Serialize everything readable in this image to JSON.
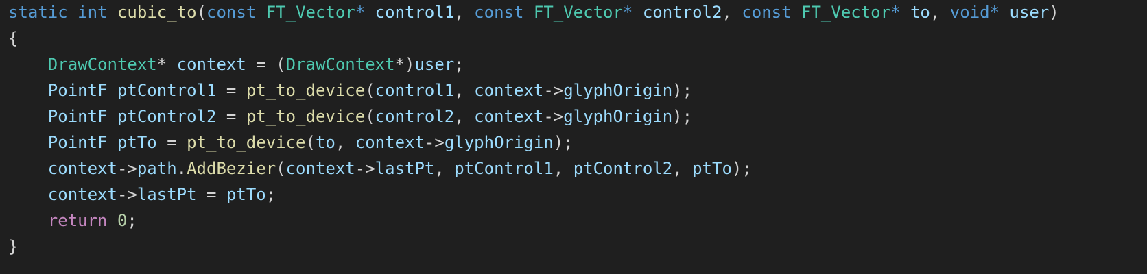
{
  "colors": {
    "background": "#1f1f1f",
    "keyword": "#569cd6",
    "type": "#4ec9b0",
    "function": "#dcdcaa",
    "variable": "#9cdcfe",
    "control": "#c586c0",
    "number": "#b5cea8",
    "punctuation": "#d4d4d4"
  },
  "lines": [
    [
      {
        "t": "static",
        "k": "kw"
      },
      {
        "t": " ",
        "k": "punc"
      },
      {
        "t": "int",
        "k": "kw"
      },
      {
        "t": " ",
        "k": "punc"
      },
      {
        "t": "cubic_to",
        "k": "fn"
      },
      {
        "t": "(",
        "k": "punc"
      },
      {
        "t": "const",
        "k": "kw"
      },
      {
        "t": " ",
        "k": "punc"
      },
      {
        "t": "FT_Vector",
        "k": "type"
      },
      {
        "t": "* ",
        "k": "kw"
      },
      {
        "t": "control1",
        "k": "var"
      },
      {
        "t": ", ",
        "k": "punc"
      },
      {
        "t": "const",
        "k": "kw"
      },
      {
        "t": " ",
        "k": "punc"
      },
      {
        "t": "FT_Vector",
        "k": "type"
      },
      {
        "t": "* ",
        "k": "kw"
      },
      {
        "t": "control2",
        "k": "var"
      },
      {
        "t": ", ",
        "k": "punc"
      },
      {
        "t": "const",
        "k": "kw"
      },
      {
        "t": " ",
        "k": "punc"
      },
      {
        "t": "FT_Vector",
        "k": "type"
      },
      {
        "t": "* ",
        "k": "kw"
      },
      {
        "t": "to",
        "k": "var"
      },
      {
        "t": ", ",
        "k": "punc"
      },
      {
        "t": "void",
        "k": "kw"
      },
      {
        "t": "* ",
        "k": "kw"
      },
      {
        "t": "user",
        "k": "var"
      },
      {
        "t": ")",
        "k": "punc"
      }
    ],
    [
      {
        "t": "{",
        "k": "punc"
      }
    ],
    [
      {
        "t": "    ",
        "k": "punc"
      },
      {
        "t": "DrawContext",
        "k": "type"
      },
      {
        "t": "* ",
        "k": "punc"
      },
      {
        "t": "context",
        "k": "var"
      },
      {
        "t": " = (",
        "k": "punc"
      },
      {
        "t": "DrawContext",
        "k": "type"
      },
      {
        "t": "*)",
        "k": "punc"
      },
      {
        "t": "user",
        "k": "var"
      },
      {
        "t": ";",
        "k": "punc"
      }
    ],
    [
      {
        "t": "    ",
        "k": "punc"
      },
      {
        "t": "PointF",
        "k": "var"
      },
      {
        "t": " ",
        "k": "punc"
      },
      {
        "t": "ptControl1",
        "k": "var"
      },
      {
        "t": " = ",
        "k": "punc"
      },
      {
        "t": "pt_to_device",
        "k": "fn"
      },
      {
        "t": "(",
        "k": "punc"
      },
      {
        "t": "control1",
        "k": "var"
      },
      {
        "t": ", ",
        "k": "punc"
      },
      {
        "t": "context",
        "k": "var"
      },
      {
        "t": "->",
        "k": "punc"
      },
      {
        "t": "glyphOrigin",
        "k": "var"
      },
      {
        "t": ");",
        "k": "punc"
      }
    ],
    [
      {
        "t": "    ",
        "k": "punc"
      },
      {
        "t": "PointF",
        "k": "var"
      },
      {
        "t": " ",
        "k": "punc"
      },
      {
        "t": "ptControl2",
        "k": "var"
      },
      {
        "t": " = ",
        "k": "punc"
      },
      {
        "t": "pt_to_device",
        "k": "fn"
      },
      {
        "t": "(",
        "k": "punc"
      },
      {
        "t": "control2",
        "k": "var"
      },
      {
        "t": ", ",
        "k": "punc"
      },
      {
        "t": "context",
        "k": "var"
      },
      {
        "t": "->",
        "k": "punc"
      },
      {
        "t": "glyphOrigin",
        "k": "var"
      },
      {
        "t": ");",
        "k": "punc"
      }
    ],
    [
      {
        "t": "    ",
        "k": "punc"
      },
      {
        "t": "PointF",
        "k": "var"
      },
      {
        "t": " ",
        "k": "punc"
      },
      {
        "t": "ptTo",
        "k": "var"
      },
      {
        "t": " = ",
        "k": "punc"
      },
      {
        "t": "pt_to_device",
        "k": "fn"
      },
      {
        "t": "(",
        "k": "punc"
      },
      {
        "t": "to",
        "k": "var"
      },
      {
        "t": ", ",
        "k": "punc"
      },
      {
        "t": "context",
        "k": "var"
      },
      {
        "t": "->",
        "k": "punc"
      },
      {
        "t": "glyphOrigin",
        "k": "var"
      },
      {
        "t": ");",
        "k": "punc"
      }
    ],
    [
      {
        "t": "    ",
        "k": "punc"
      },
      {
        "t": "context",
        "k": "var"
      },
      {
        "t": "->",
        "k": "punc"
      },
      {
        "t": "path",
        "k": "var"
      },
      {
        "t": ".",
        "k": "punc"
      },
      {
        "t": "AddBezier",
        "k": "fn"
      },
      {
        "t": "(",
        "k": "punc"
      },
      {
        "t": "context",
        "k": "var"
      },
      {
        "t": "->",
        "k": "punc"
      },
      {
        "t": "lastPt",
        "k": "var"
      },
      {
        "t": ", ",
        "k": "punc"
      },
      {
        "t": "ptControl1",
        "k": "var"
      },
      {
        "t": ", ",
        "k": "punc"
      },
      {
        "t": "ptControl2",
        "k": "var"
      },
      {
        "t": ", ",
        "k": "punc"
      },
      {
        "t": "ptTo",
        "k": "var"
      },
      {
        "t": ");",
        "k": "punc"
      }
    ],
    [
      {
        "t": "    ",
        "k": "punc"
      },
      {
        "t": "context",
        "k": "var"
      },
      {
        "t": "->",
        "k": "punc"
      },
      {
        "t": "lastPt",
        "k": "var"
      },
      {
        "t": " = ",
        "k": "punc"
      },
      {
        "t": "ptTo",
        "k": "var"
      },
      {
        "t": ";",
        "k": "punc"
      }
    ],
    [
      {
        "t": "    ",
        "k": "punc"
      },
      {
        "t": "return",
        "k": "ctrl"
      },
      {
        "t": " ",
        "k": "punc"
      },
      {
        "t": "0",
        "k": "num"
      },
      {
        "t": ";",
        "k": "punc"
      }
    ],
    [
      {
        "t": "}",
        "k": "punc"
      }
    ]
  ]
}
